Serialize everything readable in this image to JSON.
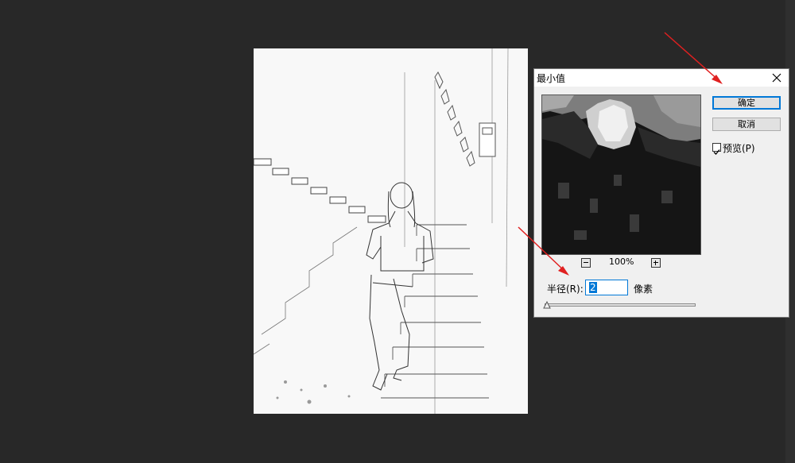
{
  "dialog": {
    "title": "最小值",
    "ok_label": "确定",
    "cancel_label": "取消",
    "preview_label": "预览(P)",
    "preview_checked": true,
    "zoom_level": "100%",
    "radius_label": "半径(R):",
    "radius_value": "2",
    "unit_label": "像素"
  },
  "colors": {
    "annotation_arrow": "#e02020",
    "focus_accent": "#0078d7",
    "workspace_bg": "#282828"
  },
  "icons": [
    "close-icon",
    "zoom-out-icon",
    "zoom-in-icon",
    "checkmark-icon",
    "slider-thumb-icon"
  ]
}
